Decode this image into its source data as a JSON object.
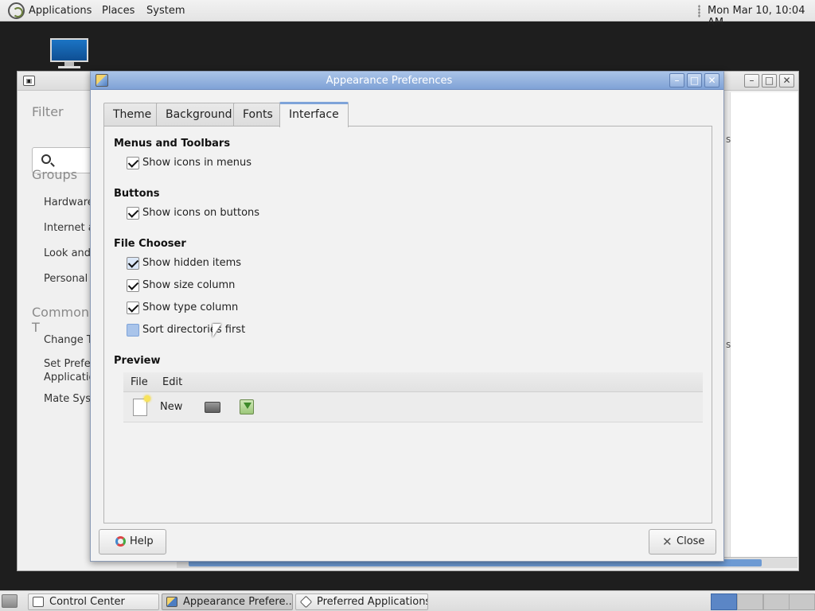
{
  "top_panel": {
    "menus": [
      "Applications",
      "Places",
      "System"
    ],
    "clock": "Mon Mar 10, 10:04 AM"
  },
  "control_center": {
    "filter_heading": "Filter",
    "groups_heading": "Groups",
    "groups": [
      "Hardware",
      "Internet a",
      "Look and",
      "Personal"
    ],
    "common_heading": "Common T",
    "common": [
      "Change T",
      "Set Prefer\nApplicatio",
      "Mate Syst"
    ],
    "fragments": [
      "s",
      "s"
    ]
  },
  "dialog": {
    "title": "Appearance Preferences",
    "tabs": [
      "Theme",
      "Background",
      "Fonts",
      "Interface"
    ],
    "active_tab": "Interface",
    "sections": {
      "menus_toolbars": {
        "title": "Menus and Toolbars",
        "show_icons_in_menus": {
          "label": "Show icons in menus",
          "checked": true
        }
      },
      "buttons": {
        "title": "Buttons",
        "show_icons_on_buttons": {
          "label": "Show icons on buttons",
          "checked": true
        }
      },
      "file_chooser": {
        "title": "File Chooser",
        "show_hidden": {
          "label": "Show hidden items",
          "checked": true
        },
        "show_size": {
          "label": "Show size column",
          "checked": true
        },
        "show_type": {
          "label": "Show type column",
          "checked": true
        },
        "sort_dirs": {
          "label": "Sort directories first",
          "checked": false
        }
      },
      "preview": {
        "title": "Preview",
        "menus": [
          "File",
          "Edit"
        ],
        "toolbar_new_label": "New"
      }
    },
    "buttons": {
      "help": "Help",
      "close": "Close"
    }
  },
  "taskbar": {
    "tasks": [
      "Control Center",
      "Appearance Prefere...",
      "Preferred Applications"
    ]
  },
  "colors": {
    "titlebar_active": "#7fa2d6",
    "tab_accent": "#7ea3d9",
    "checkbox_hover": "#a9c4ea"
  }
}
